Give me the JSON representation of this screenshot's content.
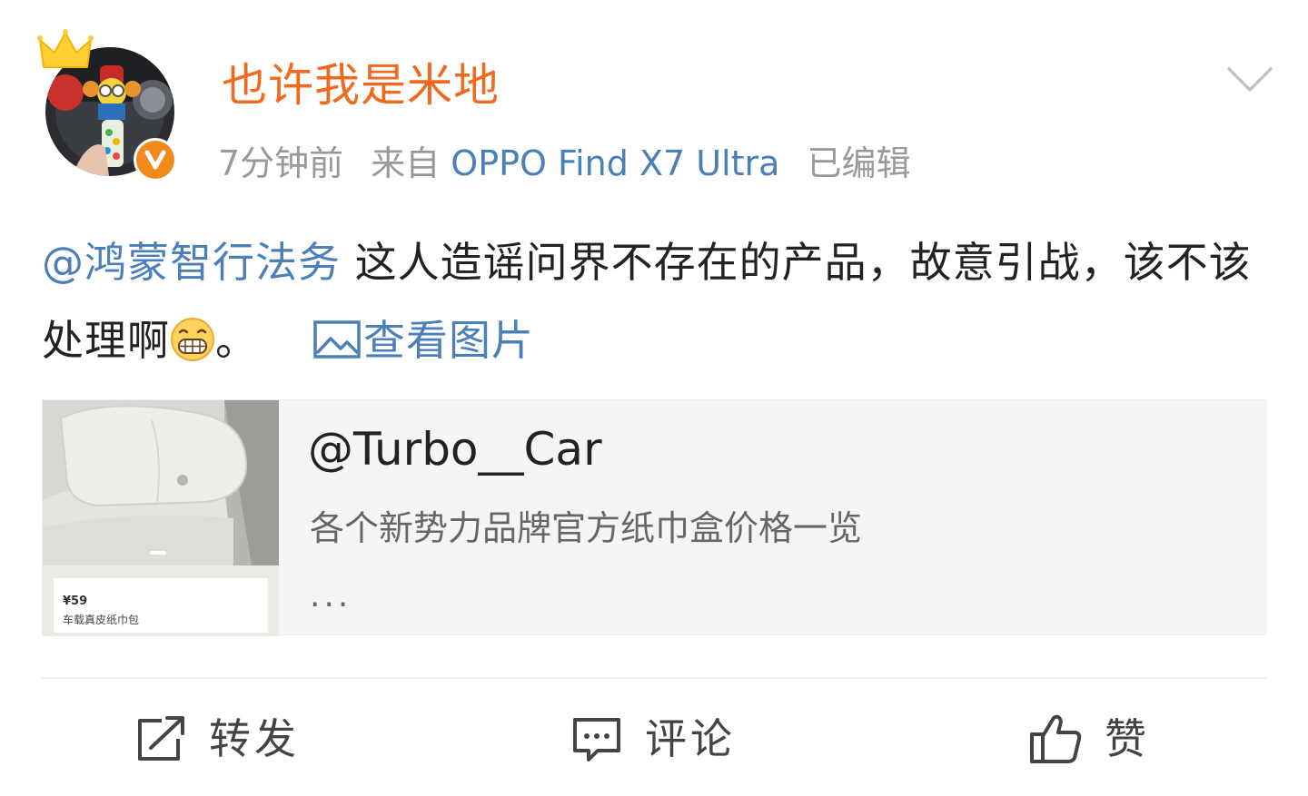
{
  "post": {
    "author": {
      "name": "也许我是米地",
      "avatar": "avatar-photo",
      "badge_icon": "verified-v-icon",
      "crown_icon": "crown-icon",
      "badge_color": "#f08a1d"
    },
    "meta": {
      "time": "7分钟前",
      "source_prefix": "来自",
      "source_device": "OPPO Find X7 Ultra",
      "edited": "已编辑"
    },
    "menu_icon": "chevron-down-icon",
    "body": {
      "mention": "@鸿蒙智行法务",
      "text": " 这人造谣问界不存在的产品，故意引战，该不该处理啊",
      "emoji": "grin-emoji-icon",
      "text_end": "。",
      "view_image_label": "查看图片",
      "view_image_icon": "image-icon"
    },
    "shared_card": {
      "thumbnail": {
        "price": "¥59",
        "title": "车载真皮纸巾包"
      },
      "author": "@Turbo__Car",
      "summary": "各个新势力品牌官方纸巾盒价格一览",
      "ellipsis": "..."
    }
  },
  "actions": {
    "repost": {
      "label": "转发",
      "icon": "repost-icon"
    },
    "comment": {
      "label": "评论",
      "icon": "comment-icon"
    },
    "like": {
      "label": "赞",
      "icon": "thumbs-up-icon"
    }
  },
  "colors": {
    "username": "#f0691d",
    "link": "#4a7fb8",
    "meta": "#999999",
    "card_bg": "#f5f5f5"
  }
}
